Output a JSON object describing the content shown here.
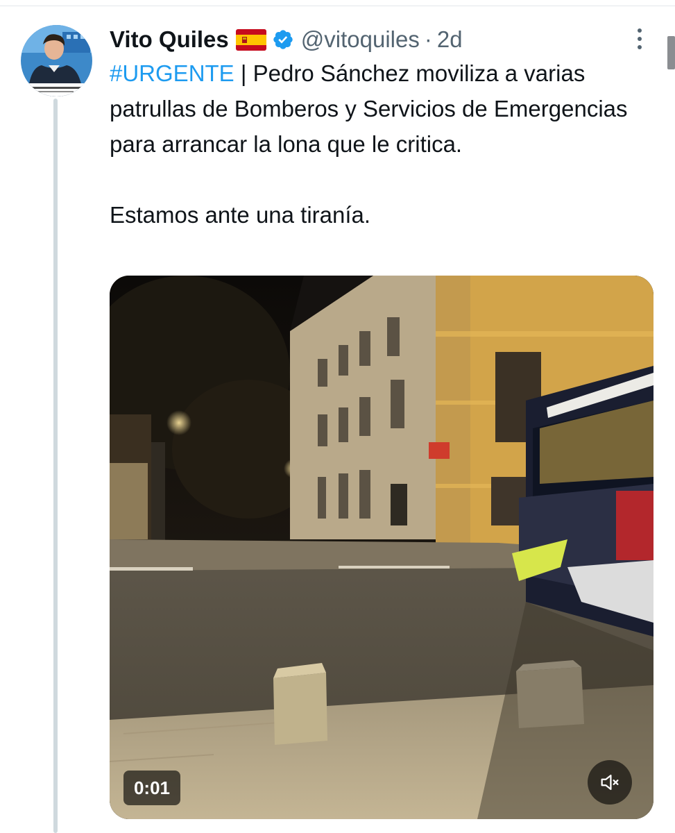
{
  "tweet": {
    "author": {
      "display_name": "Vito Quiles",
      "flag_icon": "spain-flag-icon",
      "verified_icon": "verified-badge-icon",
      "handle": "@vitoquiles",
      "separator": "·",
      "time_ago": "2d"
    },
    "text": {
      "hashtag": "#URGENTE",
      "line1_rest": " | Pedro Sánchez moviliza a varias patrullas de Bomberos y Servicios de Emergencias para arrancar la lona que le critica.",
      "line2": "Estamos ante una tiranía."
    },
    "video": {
      "elapsed": "0:01",
      "mute_icon": "volume-muted-icon"
    },
    "colors": {
      "hashtag": "#1d9bf0",
      "verified": "#1d9bf0",
      "secondary_text": "#536471",
      "thread_line": "#cfd9de"
    }
  }
}
